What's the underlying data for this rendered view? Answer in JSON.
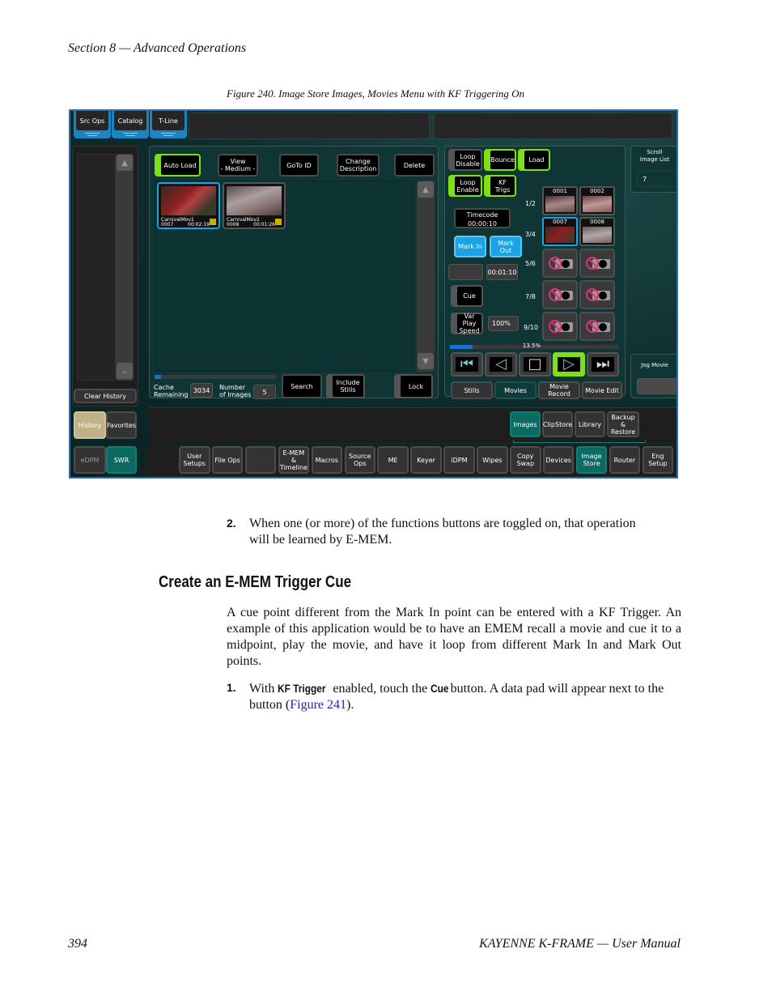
{
  "page": {
    "running_head": "Section 8 — Advanced Operations",
    "figure_caption": "Figure 240.  Image Store Images, Movies Menu with KF Triggering On",
    "footer_page_number": "394",
    "footer_title": "KAYENNE K-FRAME  —  User Manual"
  },
  "ui": {
    "top_tabs": [
      "Src Ops",
      "Catalog",
      "T-Line"
    ],
    "left": {
      "clear_history": "Clear History",
      "history": "History",
      "favorites": "Favorites",
      "edpm": "eDPM",
      "swr": "SWR"
    },
    "images_panel": {
      "buttons": {
        "auto_load": "Auto Load",
        "view": "View\n- Medium -",
        "goto_id": "GoTo ID",
        "change_description": "Change\nDescription",
        "delete": "Delete",
        "search": "Search",
        "include_stills": "Include\nStills",
        "lock": "Lock"
      },
      "thumbnails": [
        {
          "name": "CarnivalMov1",
          "id": "0007",
          "duration": "00:02:19",
          "selected": true
        },
        {
          "name": "CarnivalMov2",
          "id": "0008",
          "duration": "00:01:26",
          "selected": false
        }
      ],
      "cache_label": "Cache\nRemaining",
      "cache_value": "3034",
      "number_label": "Number\nof Images",
      "number_value": "5",
      "cache_used_fraction": 0.05
    },
    "movie_panel": {
      "loop_disable": "Loop\nDisable",
      "bounce": "Bounce",
      "load": "Load",
      "loop_enable": "Loop\nEnable",
      "kf_trigs": "KF Trigs",
      "timecode_label": "Timecode",
      "timecode_value": "00:00:10",
      "mark_in": "Mark In",
      "mark_out": "Mark Out",
      "mark_in_value": "",
      "mark_out_value": "00:01:10",
      "cue": "Cue",
      "var_play_speed": "Var Play\nSpeed",
      "speed_value": "100%",
      "progress_label": "13.5%",
      "progress_fraction": 0.135,
      "channel_labels": [
        "1/2",
        "3/4",
        "5/6",
        "7/8",
        "9/10"
      ],
      "channels": [
        {
          "a": "0001",
          "b": "0002"
        },
        {
          "a": "0007",
          "b": "0008"
        }
      ],
      "transport": [
        "rewind-to-start",
        "play-reverse",
        "stop",
        "play-forward",
        "go-to-end"
      ],
      "tabs": [
        "Stills",
        "Movies",
        "Movie Record",
        "Movie Edit"
      ],
      "active_tab": "Movies"
    },
    "right": {
      "scroll_label": "Scroll\nImage List",
      "scroll_value": "7",
      "jog_label": "Jog Movie"
    },
    "sub_tabs": [
      "Images",
      "ClipStore",
      "Library",
      "Backup &\nRestore"
    ],
    "bottom_menu": [
      "User\nSetups",
      "File Ops",
      "",
      "E-MEM &\nTimeline",
      "Macros",
      "Source\nOps",
      "ME",
      "Keyer",
      "iDPM",
      "Wipes",
      "Copy\nSwap",
      "Devices",
      "Image\nStore",
      "Router",
      "Eng\nSetup"
    ]
  },
  "content": {
    "step2_num": "2.",
    "step2_text": "When one (or more) of the functions buttons are toggled on, that operation will be learned by E-MEM.",
    "heading": "Create an E-MEM Trigger Cue",
    "para": "A cue point different from the Mark In point can be entered with a KF Trigger. An example of this application would be to have an EMEM recall a movie and cue it to a midpoint, play the movie, and have it loop from different Mark In and Mark Out points.",
    "step1_num": "1.",
    "step1_pre": "With ",
    "step1_b1": "KF Trigger",
    "step1_mid": " enabled, touch the ",
    "step1_b2": "Cue",
    "step1_post": " button. A data pad will appear next to the button (",
    "step1_link": "Figure 241",
    "step1_end": ")."
  }
}
